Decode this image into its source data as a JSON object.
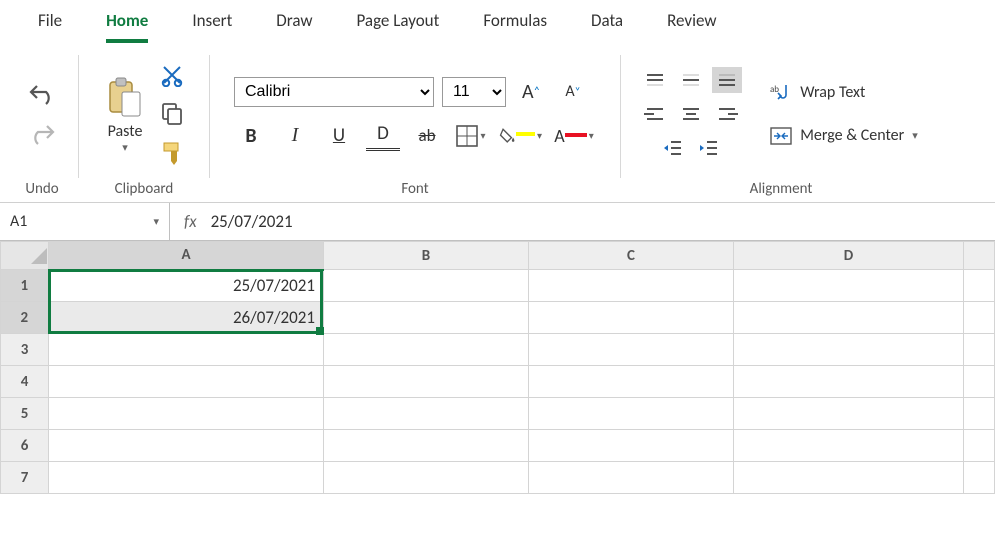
{
  "tabs": {
    "file": "File",
    "home": "Home",
    "insert": "Insert",
    "draw": "Draw",
    "page_layout": "Page Layout",
    "formulas": "Formulas",
    "data": "Data",
    "review": "Review"
  },
  "ribbon": {
    "undo_label": "Undo",
    "clipboard_label": "Clipboard",
    "paste_label": "Paste",
    "font_label": "Font",
    "alignment_label": "Alignment",
    "font_name_options": [
      "Calibri"
    ],
    "font_name": "Calibri",
    "font_size_options": [
      "11"
    ],
    "font_size": "11",
    "wrap_text": "Wrap Text",
    "merge_center": "Merge & Center"
  },
  "formula_bar": {
    "name_box": "A1",
    "fx_label": "fx",
    "formula": "25/07/2021"
  },
  "grid": {
    "columns": [
      "A",
      "B",
      "C",
      "D"
    ],
    "row_count": 7,
    "selected_cols": [
      "A"
    ],
    "selected_rows": [
      1,
      2
    ],
    "cells": {
      "A1": "25/07/2021",
      "A2": "26/07/2021"
    }
  }
}
